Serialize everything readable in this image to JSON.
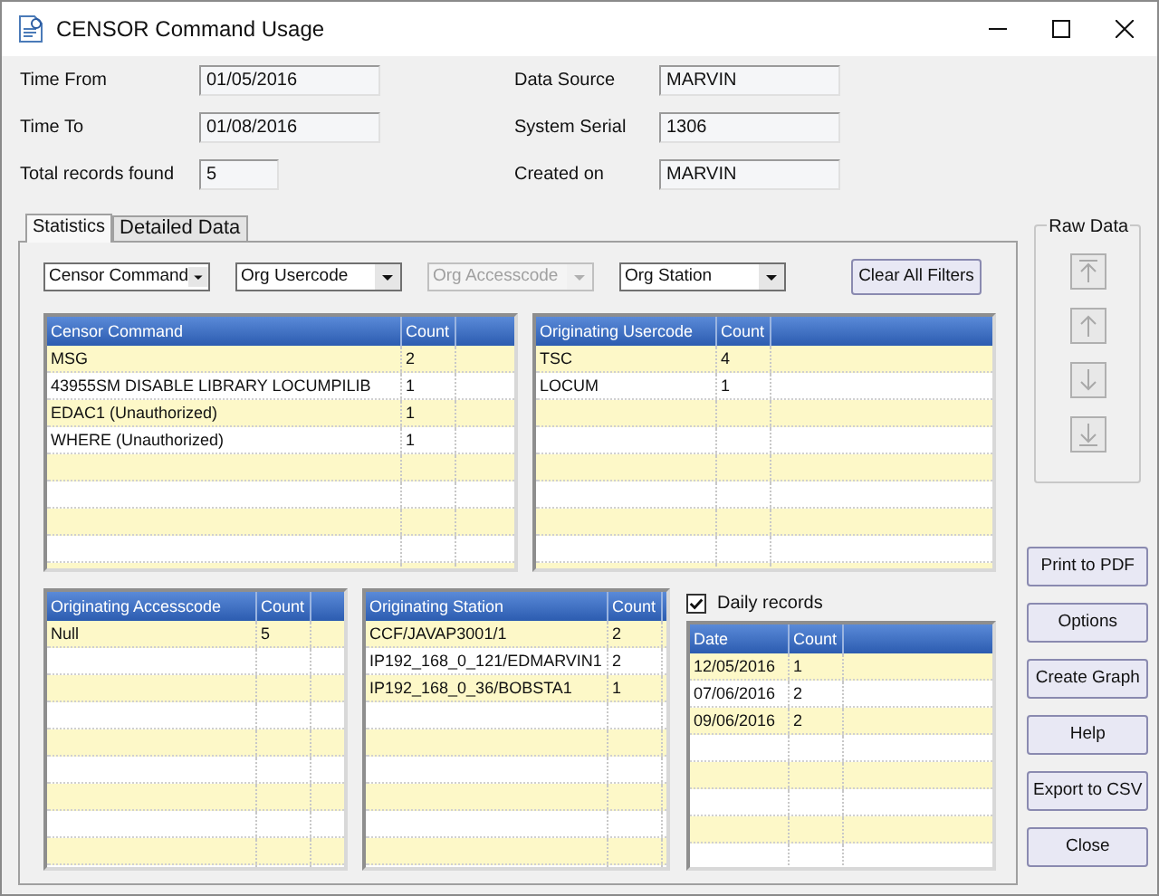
{
  "window": {
    "title": "CENSOR Command Usage"
  },
  "fields": [
    {
      "label": "Time From",
      "value": "01/05/2016",
      "kind": "wide"
    },
    {
      "label": "Data Source",
      "value": "MARVIN",
      "kind": "wide"
    },
    {
      "label": "Time To",
      "value": "01/08/2016",
      "kind": "wide"
    },
    {
      "label": "System Serial",
      "value": "1306",
      "kind": "wide"
    },
    {
      "label": "Total records found",
      "value": "5",
      "kind": "narrow"
    },
    {
      "label": "Created on",
      "value": "MARVIN",
      "kind": "wide"
    }
  ],
  "tabs": [
    {
      "label": "Statistics",
      "selected": true
    },
    {
      "label": "Detailed Data",
      "selected": false
    }
  ],
  "filters": [
    {
      "value": "Censor Command",
      "disabled": false
    },
    {
      "value": "Org Usercode",
      "disabled": false
    },
    {
      "value": "Org Accesscode",
      "disabled": true
    },
    {
      "value": "Org Station",
      "disabled": false
    }
  ],
  "clear_button": "Clear All Filters",
  "grids": [
    {
      "columns": [
        "Censor Command",
        "Count"
      ],
      "rows": [
        [
          "MSG",
          "2"
        ],
        [
          "43955SM DISABLE LIBRARY LOCUMPILIB",
          "1"
        ],
        [
          "EDAC1 (Unauthorized)",
          "1"
        ],
        [
          "WHERE (Unauthorized)",
          "1"
        ]
      ]
    },
    {
      "columns": [
        "Originating Usercode",
        "Count"
      ],
      "rows": [
        [
          "TSC",
          "4"
        ],
        [
          "LOCUM",
          "1"
        ]
      ]
    },
    {
      "columns": [
        "Originating Accesscode",
        "Count"
      ],
      "rows": [
        [
          "Null",
          "5"
        ]
      ]
    },
    {
      "columns": [
        "Originating Station",
        "Count"
      ],
      "rows": [
        [
          "CCF/JAVAP3001/1",
          "2"
        ],
        [
          "IP192_168_0_121/EDMARVIN1",
          "2"
        ],
        [
          "IP192_168_0_36/BOBSTA1",
          "1"
        ]
      ]
    },
    {
      "columns": [
        "Date",
        "Count"
      ],
      "rows": [
        [
          "12/05/2016",
          "1"
        ],
        [
          "07/06/2016",
          "2"
        ],
        [
          "09/06/2016",
          "2"
        ]
      ]
    }
  ],
  "daily_records": {
    "label": "Daily records",
    "checked": true
  },
  "raw_data": {
    "title": "Raw Data"
  },
  "buttons": [
    "Print to PDF",
    "Options",
    "Create Graph",
    "Help",
    "Export to CSV",
    "Close"
  ]
}
